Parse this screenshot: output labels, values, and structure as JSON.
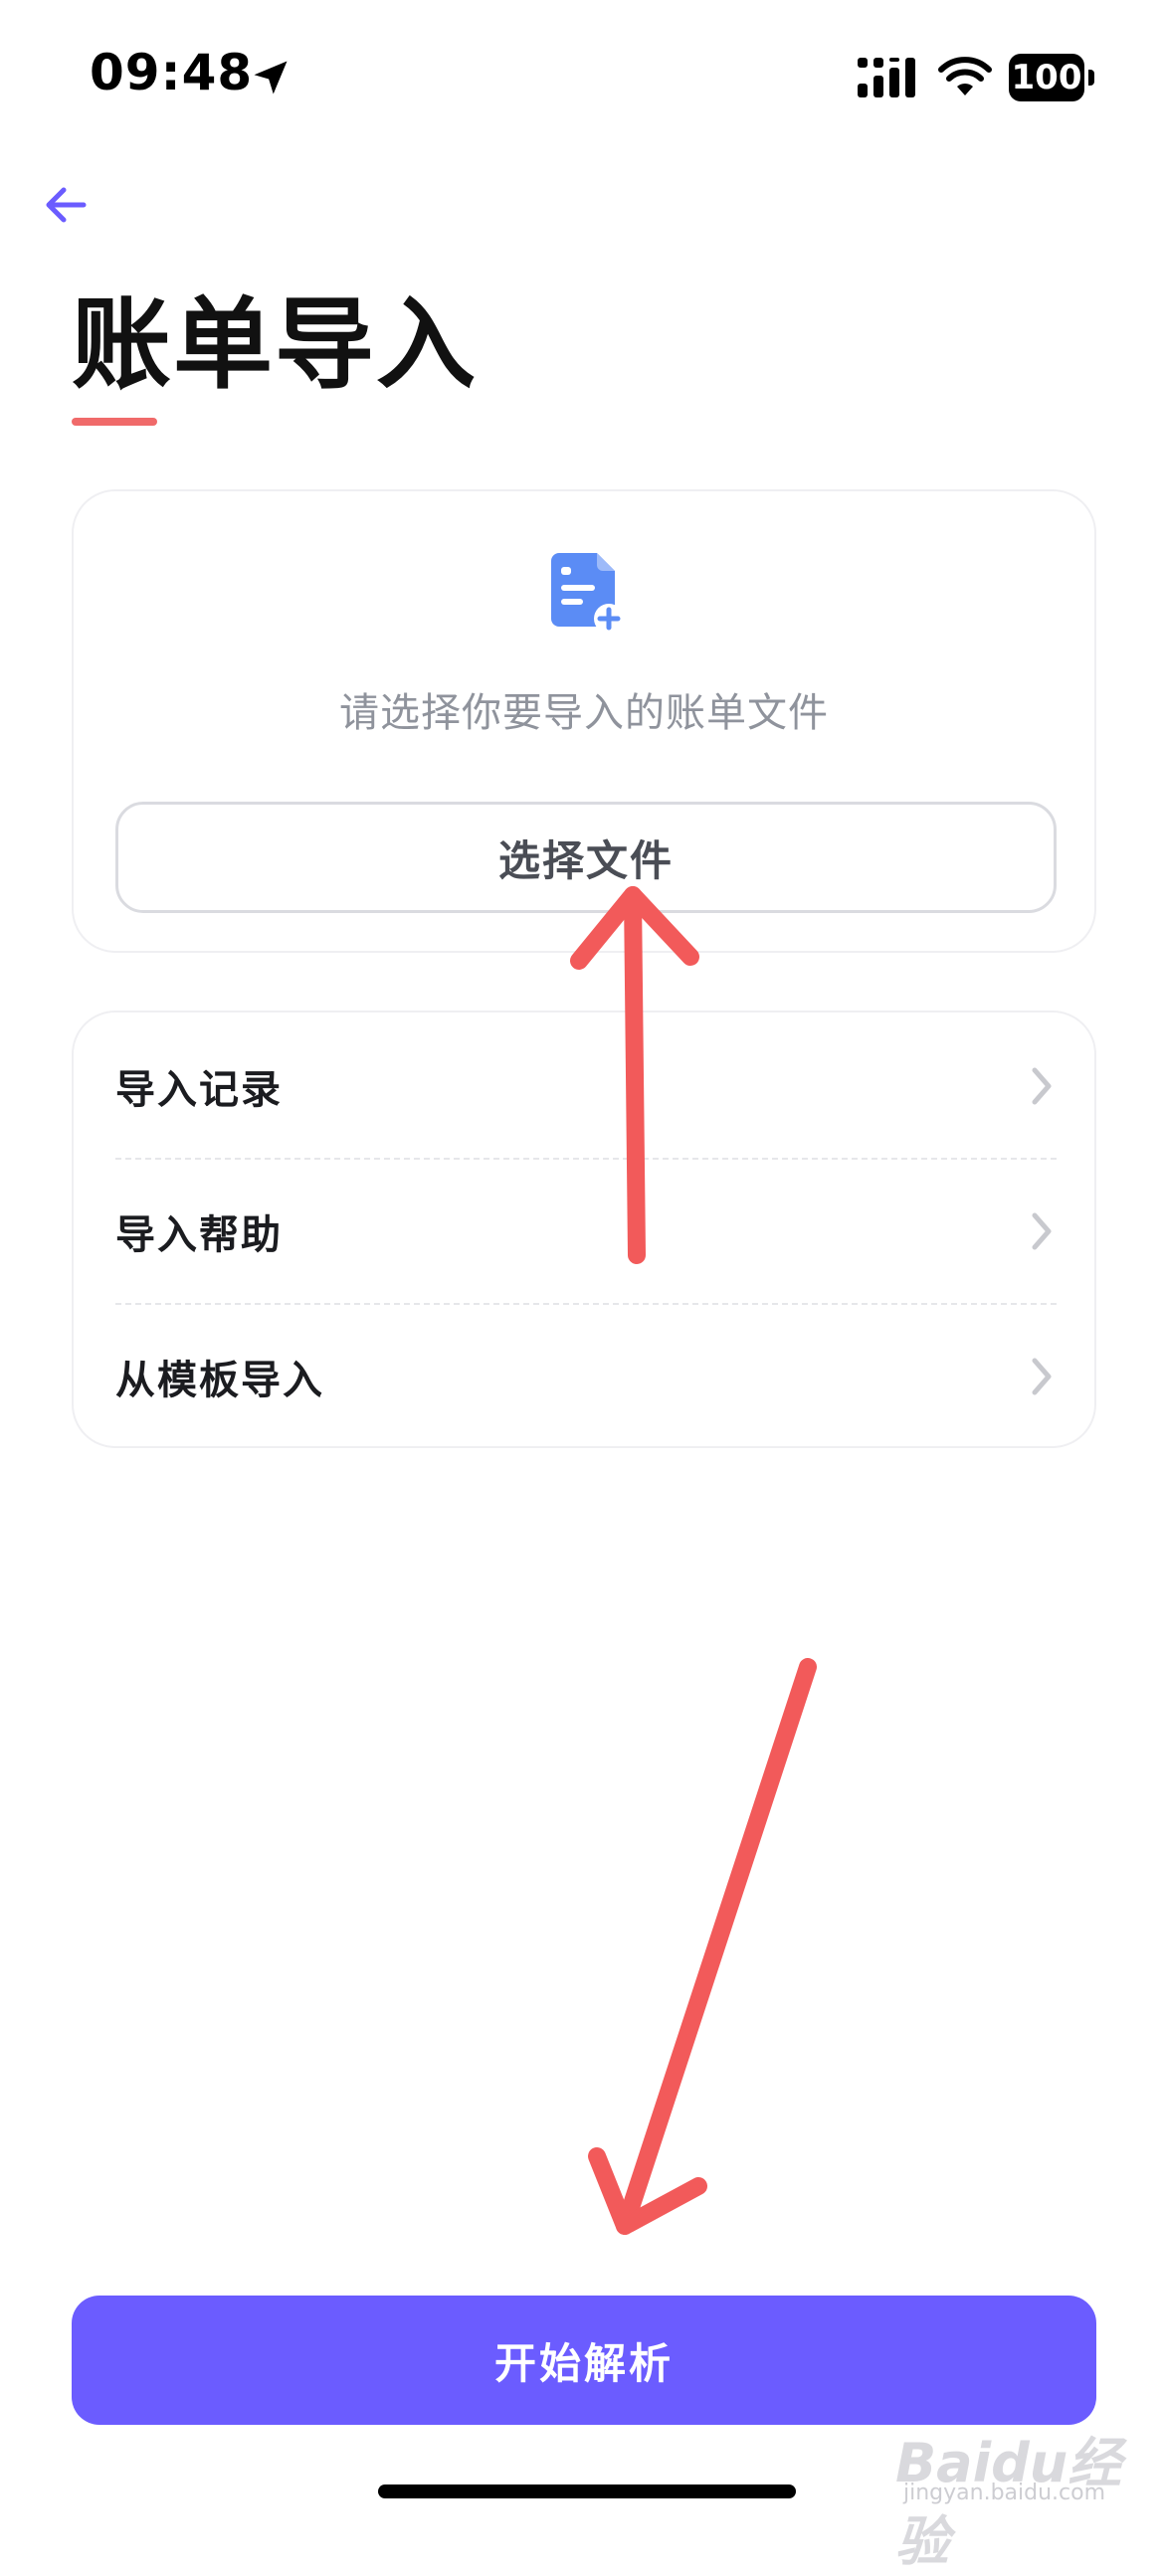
{
  "status_bar": {
    "time": "09:48",
    "battery": "100",
    "icons": [
      "location-arrow-icon",
      "cellular-signal-icon",
      "wifi-icon",
      "battery-icon"
    ]
  },
  "header": {
    "back_icon": "arrow-left-icon",
    "title": "账单导入"
  },
  "upload_card": {
    "icon": "file-add-icon",
    "hint": "请选择你要导入的账单文件",
    "choose_button_label": "选择文件"
  },
  "menu": {
    "items": [
      {
        "label": "导入记录",
        "icon": "chevron-right-icon"
      },
      {
        "label": "导入帮助",
        "icon": "chevron-right-icon"
      },
      {
        "label": "从模板导入",
        "icon": "chevron-right-icon"
      }
    ]
  },
  "primary_action": {
    "label": "开始解析"
  },
  "watermark": {
    "brand": "Baidu经验",
    "url": "jingyan.baidu.com"
  },
  "colors": {
    "accent": "#6b5cff",
    "title_underline": "#f06a6a",
    "annotation_arrow": "#f25a5a",
    "file_icon": "#5b8cf5"
  }
}
